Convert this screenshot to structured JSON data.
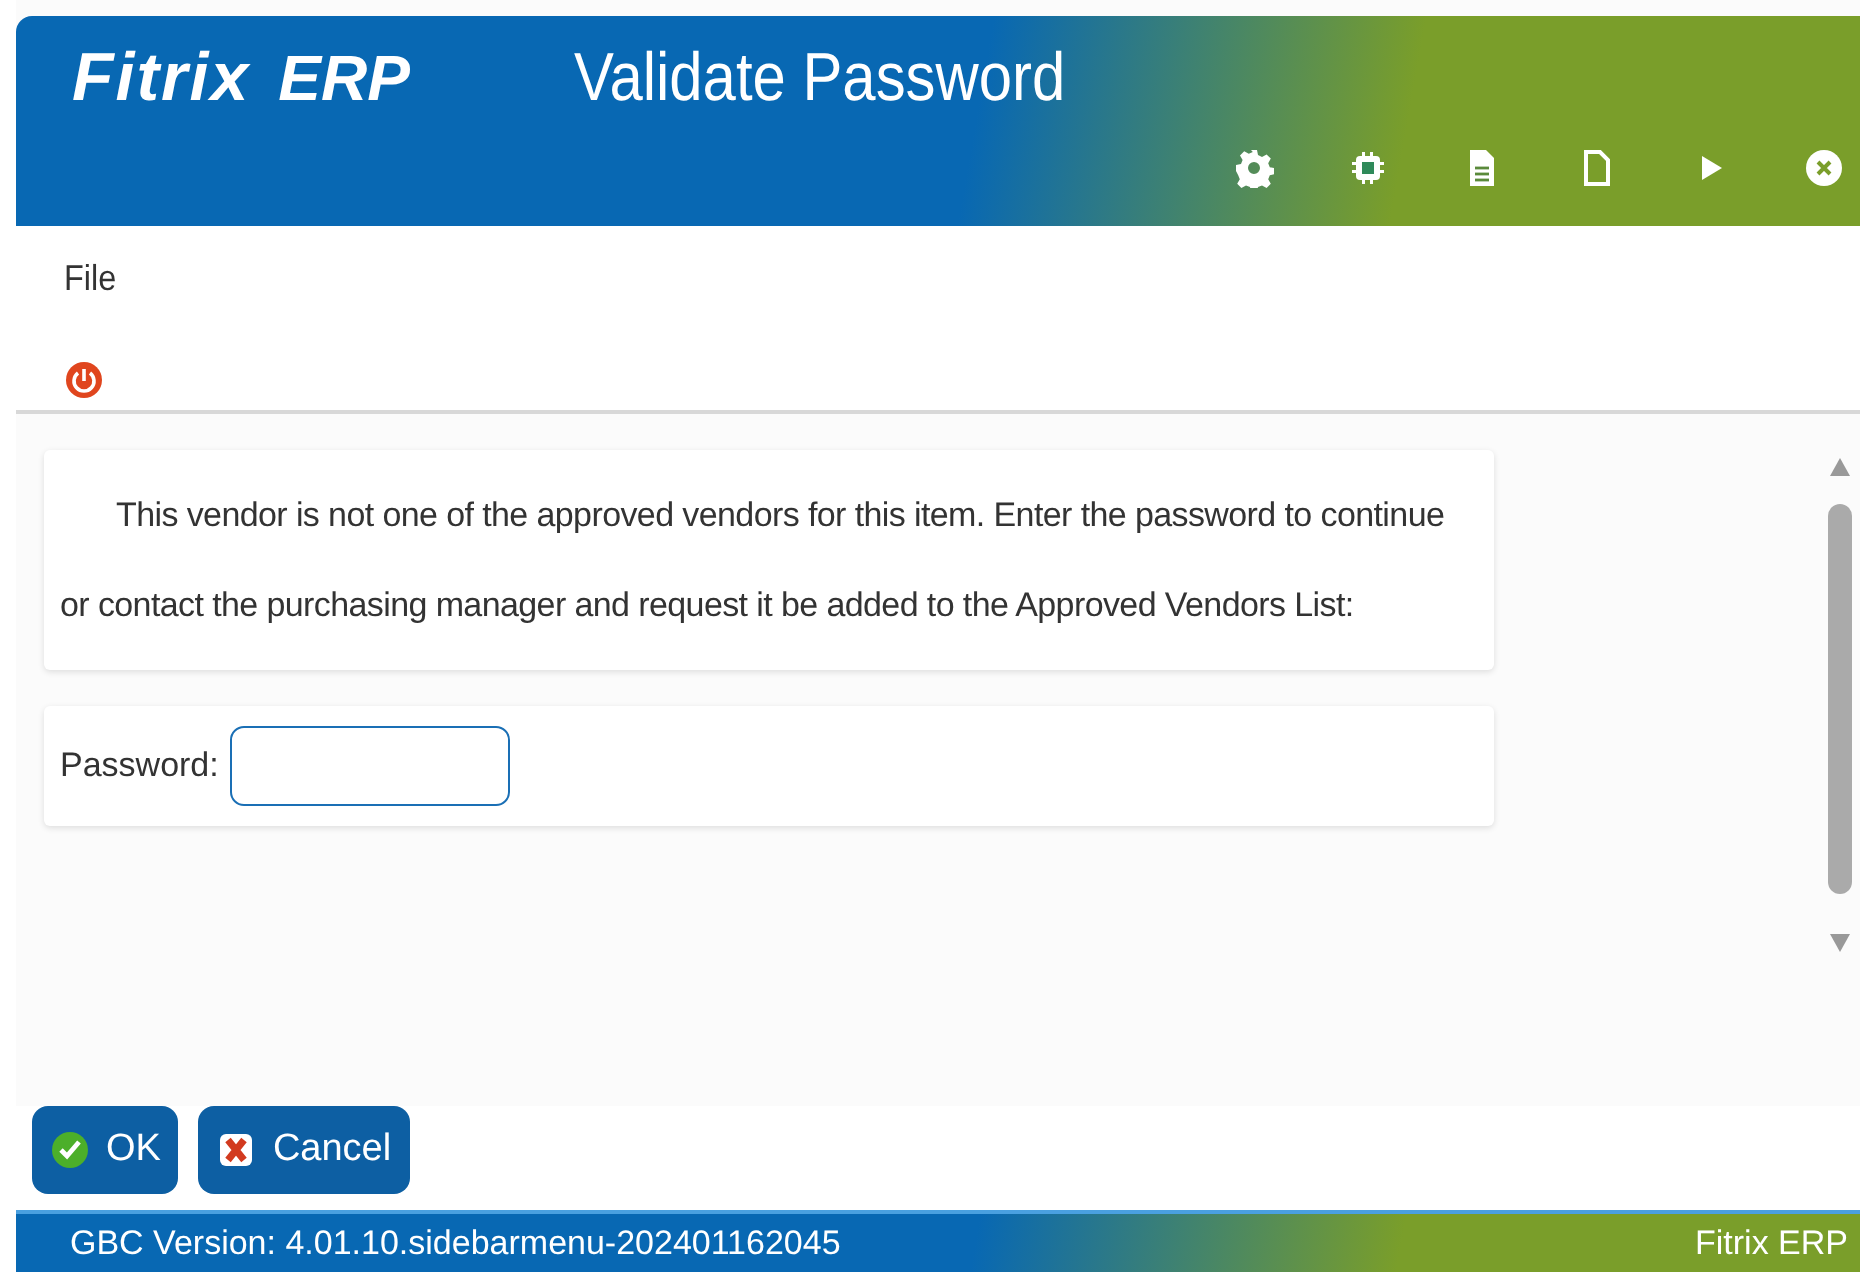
{
  "header": {
    "logo": "Fitrix",
    "logo_suffix": "ERP",
    "title": "Validate Password",
    "toolbar": [
      {
        "kind": "gear"
      },
      {
        "kind": "chip"
      },
      {
        "kind": "document"
      },
      {
        "kind": "page"
      },
      {
        "kind": "play"
      },
      {
        "kind": "close"
      }
    ]
  },
  "menu": {
    "items": [
      "File"
    ]
  },
  "message": "This vendor is not one of the approved vendors for this item. Enter the password to continue or contact the purchasing manager and request it be added to the Approved Vendors List:",
  "password": {
    "label": "Password:"
  },
  "buttons": [
    {
      "kind": "ok",
      "label": "OK"
    },
    {
      "kind": "cancel",
      "label": "Cancel"
    }
  ],
  "status_bar": {
    "version": "GBC Version: 4.01.10.sidebarmenu-202401162045",
    "app": "Fitrix ERP"
  }
}
